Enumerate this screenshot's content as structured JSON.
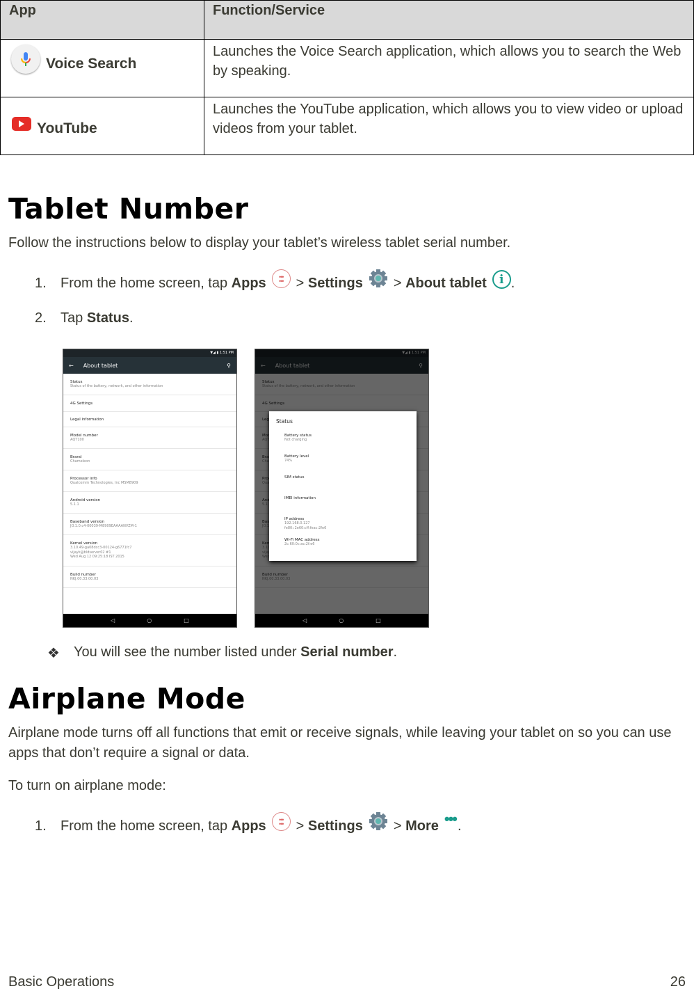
{
  "table": {
    "headers": [
      "App",
      "Function/Service"
    ],
    "rows": [
      {
        "app": "Voice Search",
        "icon": "microphone-icon",
        "desc": "Launches the Voice Search application, which allows you to search the Web by speaking."
      },
      {
        "app": "YouTube",
        "icon": "youtube-icon",
        "desc": "Launches the YouTube application, which allows you to view video or upload videos from your tablet."
      }
    ]
  },
  "tablet_number": {
    "title": "Tablet Number",
    "intro": "Follow the instructions below to display your tablet’s wireless tablet serial number.",
    "step1": {
      "num": "1.",
      "pre": "From the home screen, tap",
      "apps": "Apps",
      "sep": ">",
      "settings": "Settings",
      "about": "About tablet",
      "end": "."
    },
    "step2": {
      "num": "2.",
      "pre": "Tap",
      "status": "Status",
      "end": "."
    },
    "note": {
      "pre": "You will see the number listed under",
      "bold": "Serial number",
      "end": "."
    }
  },
  "phone": {
    "status_bar": "▼◢ ▮ 1:51 PM",
    "title": "About tablet",
    "items": [
      {
        "t": "Status",
        "s": [
          "Status of the battery, network, and other information"
        ],
        "h": 31
      },
      {
        "t": "4G Settings",
        "s": [],
        "h": 24
      },
      {
        "t": "Legal information",
        "s": [],
        "h": 22
      },
      {
        "t": "Model number",
        "s": [
          "AQT100"
        ],
        "h": 31
      },
      {
        "t": "Brand",
        "s": [
          "Chameleon"
        ],
        "h": 31
      },
      {
        "t": "Processor info",
        "s": [
          "Qualcomm Technologies, Inc MSM8909"
        ],
        "h": 31
      },
      {
        "t": "Android version",
        "s": [
          "5.1.1"
        ],
        "h": 31
      },
      {
        "t": "Baseband version",
        "s": [
          "JO.1.0.c4-00039-M8909EAAAANVZM-1"
        ],
        "h": 31
      },
      {
        "t": "Kernel version",
        "s": [
          "3.10.49-ga08dcc3-00124-g6771fc7",
          "vijayk@bldserver02 #1",
          "Wed Aug 12 09:25:18 IST 2015"
        ],
        "h": 45
      },
      {
        "t": "Build number",
        "s": [
          "NKJ.00.33.00.03"
        ],
        "h": 31
      }
    ],
    "dialog": {
      "title": "Status",
      "items": [
        {
          "t": "Battery status",
          "s": [
            "Not charging"
          ]
        },
        {
          "t": "Battery level",
          "s": [
            "74%"
          ]
        },
        {
          "t": "SIM status",
          "s": []
        },
        {
          "t": "IMEI information",
          "s": []
        },
        {
          "t": "IP address",
          "s": [
            "192.168.0.127",
            "fe80::2e60:cff:feac:2fe6"
          ]
        },
        {
          "t": "Wi-Fi MAC address",
          "s": [
            "2c:60:0c:ac:2f:e6"
          ]
        }
      ]
    },
    "nav": [
      "◁",
      "○",
      "□"
    ]
  },
  "airplane": {
    "title": "Airplane Mode",
    "intro": "Airplane mode turns off all functions that emit or receive signals, while leaving your tablet on so you can use apps that don’t require a signal or data.",
    "to_turn_on": "To turn on airplane mode:",
    "step1": {
      "num": "1.",
      "pre": "From the home screen, tap",
      "apps": "Apps",
      "sep": ">",
      "settings": "Settings",
      "more": "More",
      "end": "."
    }
  },
  "footer": {
    "section": "Basic Operations",
    "page": "26"
  },
  "colors": {
    "accent": "#1a9c8c",
    "youtube": "#e52d27",
    "toolbar": "#263238"
  }
}
